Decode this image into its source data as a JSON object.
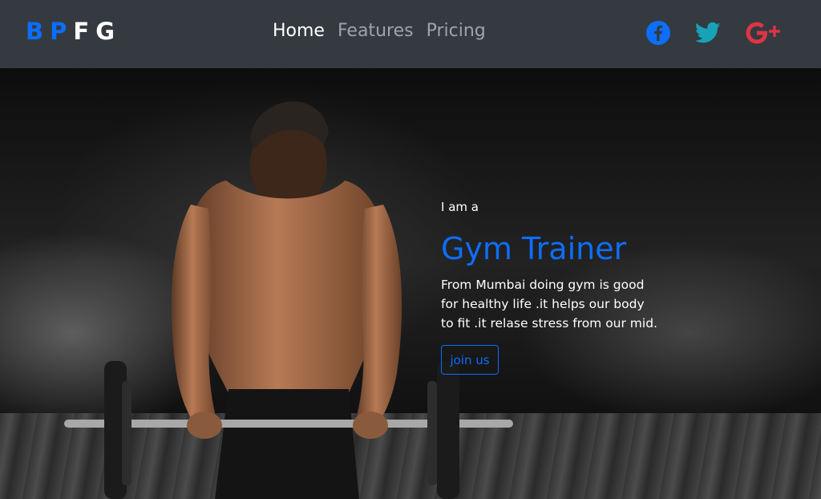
{
  "brand": {
    "letters": [
      "B",
      "P",
      "F",
      "G"
    ],
    "colors": [
      "#0d6efd",
      "#0d6efd",
      "#ffffff",
      "#ffffff"
    ]
  },
  "nav": {
    "items": [
      {
        "label": "Home",
        "active": true
      },
      {
        "label": "Features",
        "active": false
      },
      {
        "label": "Pricing",
        "active": false
      }
    ]
  },
  "social": [
    {
      "icon": "facebook-icon",
      "color": "#0d6efd"
    },
    {
      "icon": "twitter-icon",
      "color": "#17a2b8"
    },
    {
      "icon": "google-plus-icon",
      "color": "#dc3545"
    }
  ],
  "hero": {
    "eyebrow": "I am a",
    "headline": "Gym Trainer",
    "description": "From Mumbai doing gym is good for healthy life .it helps our body to fit .it relase stress from our mid.",
    "cta_label": "join us",
    "accent_color": "#0d6efd",
    "image": "fitness-trainer-lifting-barbell-photo"
  },
  "theme": {
    "navbar_bg": "#343a40"
  }
}
